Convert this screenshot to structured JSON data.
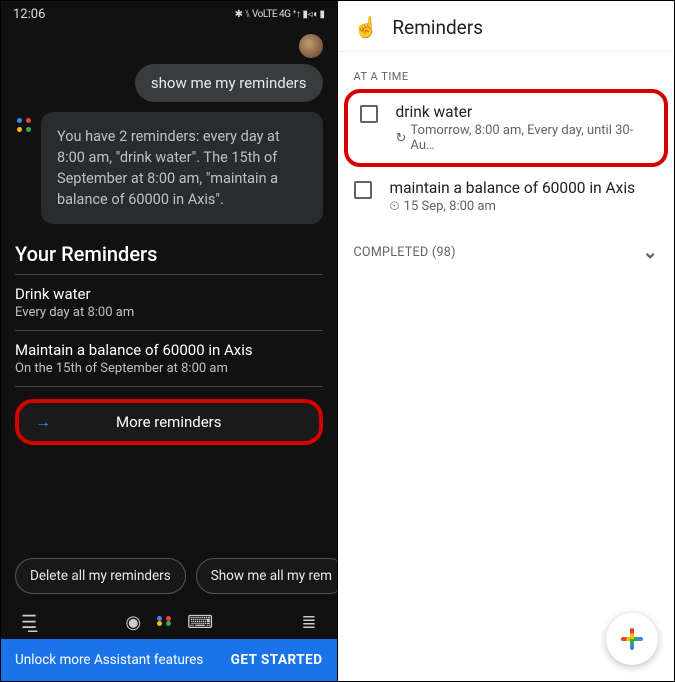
{
  "left": {
    "status": {
      "time": "12:06",
      "icons": "✱ ⑊ VoLTE 4G ⁺↑ ▮◃◖ ▮"
    },
    "chat": {
      "user_message": "show me my reminders",
      "assistant_message": "You have 2 reminders: every day at 8:00 am, \"drink water\". The 15th of September at 8:00 am, \"maintain a balance of 60000 in Axis\"."
    },
    "card": {
      "title": "Your Reminders",
      "items": [
        {
          "title": "Drink water",
          "subtitle": "Every day at 8:00 am"
        },
        {
          "title": "Maintain a balance of 60000 in Axis",
          "subtitle": "On the 15th of September at 8:00 am"
        }
      ],
      "more_label": "More reminders"
    },
    "suggestions": [
      "Delete all my reminders",
      "Show me all my rem"
    ],
    "promo": {
      "text": "Unlock more Assistant features",
      "cta": "GET STARTED"
    }
  },
  "right": {
    "header": {
      "title": "Reminders"
    },
    "section_label": "AT A TIME",
    "items": [
      {
        "title": "drink water",
        "icon": "↻",
        "subtitle": "Tomorrow, 8:00 am, Every day, until 30-Au…",
        "highlight": true
      },
      {
        "title": "maintain a balance of 60000 in Axis",
        "icon": "⏲",
        "subtitle": "15 Sep, 8:00 am",
        "highlight": false
      }
    ],
    "completed": {
      "label": "COMPLETED (98)",
      "chevron": "⌄"
    }
  }
}
